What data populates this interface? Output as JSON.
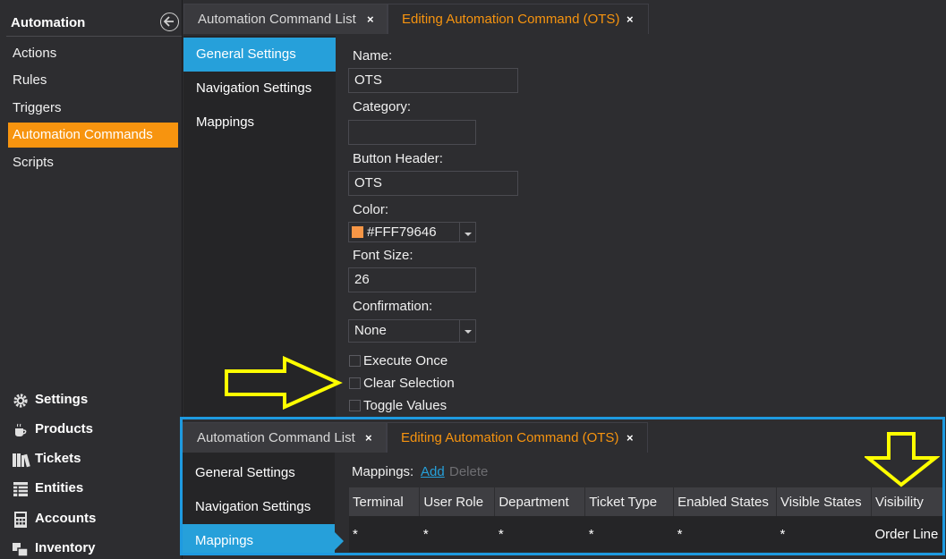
{
  "sidebar": {
    "title": "Automation",
    "back_icon": "back-arrow-circle-icon",
    "items": [
      {
        "label": "Actions"
      },
      {
        "label": "Rules"
      },
      {
        "label": "Triggers"
      },
      {
        "label": "Automation Commands",
        "active": true
      },
      {
        "label": "Scripts"
      }
    ],
    "bottom": [
      {
        "label": "Settings",
        "icon": "gear-icon"
      },
      {
        "label": "Products",
        "icon": "coffee-cup-icon"
      },
      {
        "label": "Tickets",
        "icon": "books-icon"
      },
      {
        "label": "Entities",
        "icon": "grid-icon"
      },
      {
        "label": "Accounts",
        "icon": "calculator-icon"
      },
      {
        "label": "Inventory",
        "icon": "boxes-icon"
      }
    ]
  },
  "tabs": [
    {
      "label": "Automation Command List",
      "close": "×"
    },
    {
      "label": "Editing Automation Command (OTS)",
      "close": "×",
      "active": true
    }
  ],
  "nav": [
    {
      "label": "General Settings",
      "active": true
    },
    {
      "label": "Navigation Settings"
    },
    {
      "label": "Mappings"
    }
  ],
  "form": {
    "name_label": "Name:",
    "name_value": "OTS",
    "category_label": "Category:",
    "category_value": "",
    "button_header_label": "Button Header:",
    "button_header_value": "OTS",
    "color_label": "Color:",
    "color_value": "#FFF79646",
    "color_swatch": "#f79646",
    "font_size_label": "Font Size:",
    "font_size_value": "26",
    "confirmation_label": "Confirmation:",
    "confirmation_value": "None",
    "checkboxes": [
      {
        "label": "Execute Once",
        "checked": false
      },
      {
        "label": "Clear Selection",
        "checked": false
      },
      {
        "label": "Toggle Values",
        "checked": false
      }
    ]
  },
  "overlay": {
    "tabs": [
      {
        "label": "Automation Command List",
        "close": "×"
      },
      {
        "label": "Editing Automation Command (OTS)",
        "close": "×",
        "active": true
      }
    ],
    "nav": [
      {
        "label": "General Settings"
      },
      {
        "label": "Navigation Settings"
      },
      {
        "label": "Mappings",
        "active": true
      }
    ],
    "mappings_label": "Mappings:",
    "add_label": "Add",
    "delete_label": "Delete",
    "columns": [
      "Terminal",
      "User Role",
      "Department",
      "Ticket Type",
      "Enabled States",
      "Visible States",
      "Visibility"
    ],
    "rows": [
      [
        "*",
        "*",
        "*",
        "*",
        "*",
        "*",
        "Order Line"
      ]
    ]
  },
  "annotations": {
    "arrow_color": "#ffff00",
    "border_color": "#1e9ae0"
  }
}
